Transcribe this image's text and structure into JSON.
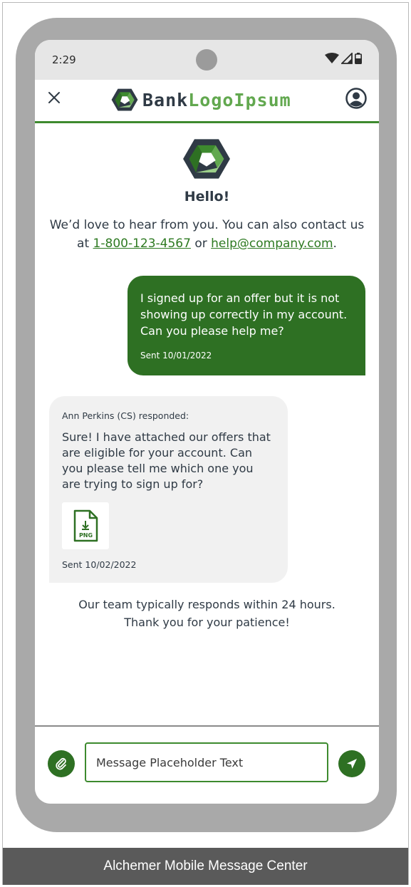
{
  "status_bar": {
    "time": "2:29"
  },
  "app_bar": {
    "brand_part1": "Bank",
    "brand_part2": "LogoIpsum",
    "accent_color": "#3d8a2e"
  },
  "greeting": {
    "title": "Hello!",
    "intro_prefix": "We’d love to hear from you. You can also contact us at",
    "phone": "1-800-123-4567",
    "intro_or": "or",
    "email": "help@company.com",
    "intro_suffix": "."
  },
  "messages": [
    {
      "direction": "outgoing",
      "text": "I signed up for an offer but it is not showing up correctly in my account. Can you please help me?",
      "timestamp": "Sent 10/01/2022"
    },
    {
      "direction": "incoming",
      "author_line": "Ann Perkins (CS) responded:",
      "text": "Sure! I have attached our offers that are eligible for your account. Can you please tell me which one you are trying to sign up for?",
      "attachment_type": "PNG",
      "timestamp": "Sent 10/02/2022"
    }
  ],
  "footer_note": {
    "line1": "Our team typically responds within 24 hours.",
    "line2": "Thank you for your patience!"
  },
  "composer": {
    "placeholder": "Message Placeholder Text",
    "value": ""
  },
  "caption": "Alchemer Mobile Message Center",
  "icons": {
    "close": "close-icon",
    "profile": "profile-icon",
    "attach": "paperclip-icon",
    "send": "send-icon",
    "file": "png-file-icon"
  }
}
